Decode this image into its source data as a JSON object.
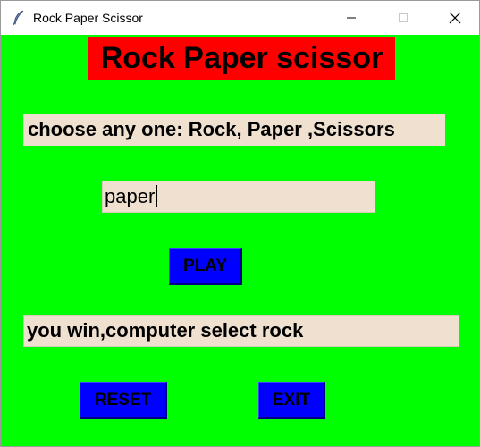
{
  "window": {
    "title": "Rock Paper Scissor",
    "icon": "feather-icon",
    "controls": [
      "minimize-icon",
      "maximize-icon",
      "close-icon"
    ]
  },
  "app": {
    "heading": "Rock Paper scissor",
    "prompt": "choose any one: Rock, Paper ,Scissors",
    "choice_value": "paper",
    "play_label": "PLAY",
    "result": "you win,computer select rock",
    "reset_label": "RESET",
    "exit_label": "EXIT"
  },
  "colors": {
    "background": "#00ff00",
    "heading_bg": "#ff0000",
    "field_bg": "#efe0d0",
    "button_bg": "#0000ff"
  }
}
